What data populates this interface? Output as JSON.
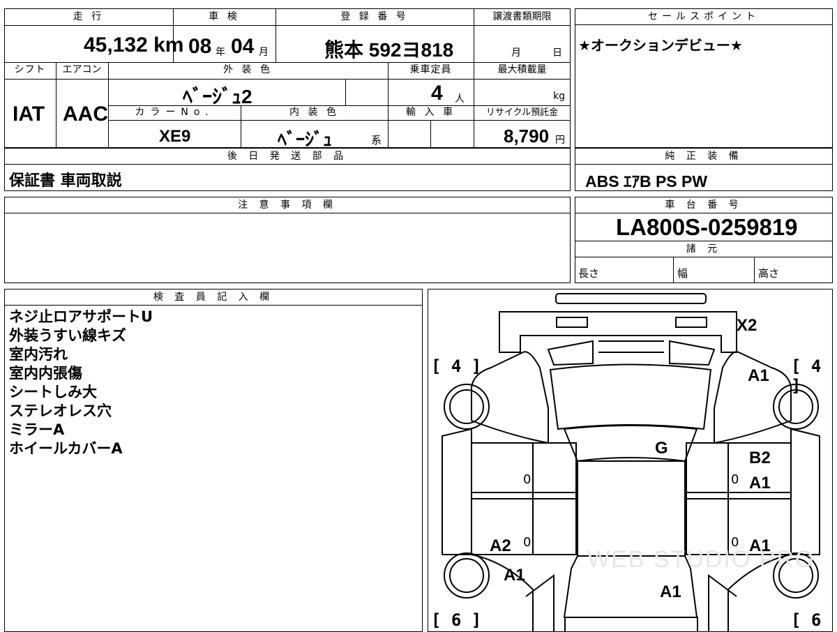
{
  "top": {
    "mileage_header": "走 行",
    "mileage_value": "45,132 km",
    "inspection_header": "車 検",
    "inspection_year": "08",
    "inspection_year_unit": "年",
    "inspection_month": "04",
    "inspection_month_unit": "月",
    "reg_header": "登 録 番 号",
    "reg_value": "熊本 592ヨ818",
    "transfer_header": "譲渡書類期限",
    "transfer_month_unit": "月",
    "transfer_day_unit": "日",
    "sales_header": "セールスポイント",
    "sales_value": "★オークションデビュー★"
  },
  "row2": {
    "shift_header": "シフト",
    "shift_value": "IAT",
    "ac_header": "エアコン",
    "ac_value": "AAC",
    "exterior_header": "外 装 色",
    "exterior_value": "ﾍﾞｰｼﾞｭ2",
    "color_no_header": "カラーNo.",
    "color_no_value": "XE9",
    "interior_header": "内 装 色",
    "interior_value": "ﾍﾞｰｼﾞｭ",
    "interior_suffix": "系",
    "capacity_header": "乗車定員",
    "capacity_value": "4",
    "capacity_unit": "人",
    "import_header": "輸 入 車",
    "maxload_header": "最大積載量",
    "maxload_unit": "kg",
    "recycle_header": "リサイクル預託金",
    "recycle_value": "8,790",
    "recycle_unit": "円"
  },
  "parts": {
    "header": "後 日 発 送 部 品",
    "value": "保証書 車両取説"
  },
  "equipment": {
    "header": "純 正 装 備",
    "value": "ABS ｴｱB PS PW"
  },
  "notes": {
    "header": "注 意 事 項 欄"
  },
  "chassis": {
    "header": "車 台 番 号",
    "value": "LA800S-0259819",
    "spec_header": "諸 元",
    "length_label": "長さ",
    "width_label": "幅",
    "height_label": "高さ"
  },
  "inspector": {
    "header": "検 査 員 記 入 欄",
    "lines": [
      "ネジ止ロアサポートU",
      "外装うすい線キズ",
      "室内汚れ",
      "室内内張傷",
      "シートしみ大",
      "ステレオレス穴",
      "ミラーA",
      "ホイールカバーA"
    ]
  },
  "diagram": {
    "marks": [
      "X2",
      "A1",
      "G",
      "B2",
      "A1",
      "A1",
      "A2",
      "A1",
      "A1"
    ],
    "tire_front_left": "4",
    "tire_front_right": "4",
    "tire_rear_left": "6",
    "tire_rear_right": "6",
    "zero_marks": [
      "0",
      "0",
      "0",
      "0"
    ],
    "watermark": "WEB STUDIO PRO"
  }
}
